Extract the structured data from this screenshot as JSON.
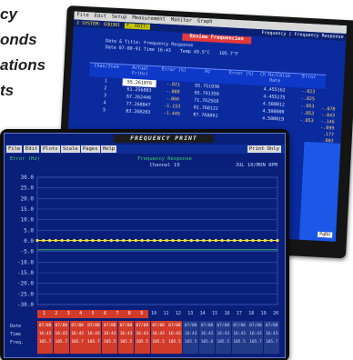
{
  "headline": {
    "lines": [
      "cy",
      "onds",
      "ations",
      "ts"
    ]
  },
  "back_screen": {
    "menubar": [
      "File",
      "Edit",
      "Setup",
      "Measurement",
      "Monitor",
      "Graph"
    ],
    "sysbar": {
      "left": "2  SYSTEM: EQU301",
      "hl": "F. EDIT:",
      "right": "Frequency | Frequency Response"
    },
    "title": "Review Frequencies",
    "info": {
      "date_label": "Date & Title: Frequency Response",
      "date": "Date 07-08-91   Time 16:43",
      "temp_label": "Temp  49.5°C",
      "temp_right": "105.7°F"
    },
    "columns": [
      "Chan/Item",
      "Actual Fr(Hz)",
      "Error (%)",
      "Hz",
      "Error (%)",
      "Ch Hz/Calib Rate",
      "Error"
    ],
    "rows": [
      {
        "ch": "1",
        "a": "55.261076",
        "b": "-.021",
        "c": "55.751930",
        "d": "",
        "e": "4.455162",
        "f": "-.023"
      },
      {
        "ch": "2",
        "a": "61.256803",
        "b": "-.009",
        "c": "65.791359",
        "d": "",
        "e": "4.455175",
        "f": "-.025"
      },
      {
        "ch": "3",
        "a": "67.262446",
        "b": "-.066",
        "c": "71.7625G9",
        "d": "",
        "e": "4.500012",
        "f": "-.053"
      },
      {
        "ch": "4",
        "a": "77.268047",
        "b": "-1.153",
        "c": "81.768122",
        "d": "",
        "e": "4.500000",
        "f": "-.053"
      },
      {
        "ch": "5",
        "a": "83.268283",
        "b": "-1.445",
        "c": "87.768861",
        "d": "",
        "e": "4.500019",
        "f": "-.053"
      }
    ],
    "side_values": [
      "-.070",
      "-.043",
      "-.146",
      "-.099",
      ".177",
      ".003",
      ".051",
      ".013",
      ".035",
      ".079",
      ".061"
    ],
    "page_button": "PgDn"
  },
  "screen": {
    "title": "FREQUENCY PRINT",
    "toolbar": [
      "File",
      "Edit",
      "Plots",
      "Scale",
      "Pages",
      "Help"
    ],
    "toolbar_right": "Print  Only",
    "plot": {
      "ylabel": "Error (Hz)",
      "title": "Frequency Response",
      "channel": "Channel 19",
      "date": "JUL 10/MON 8PM"
    },
    "channels": [
      "1",
      "2",
      "3",
      "4",
      "5",
      "6",
      "7",
      "8",
      "9",
      "10",
      "11",
      "12",
      "13",
      "14",
      "15",
      "16",
      "17",
      "18",
      "19",
      "20"
    ],
    "channels_active": 9,
    "row_labels": [
      "Date",
      "Time",
      "Freq."
    ],
    "cells": [
      [
        "07/08",
        "16:43",
        "105.7"
      ],
      [
        "07/08",
        "16:43",
        "105.7"
      ],
      [
        "07/08",
        "16:43",
        "105.7"
      ],
      [
        "07/08",
        "16:43",
        "105.7"
      ],
      [
        "07/08",
        "16:43",
        "105.5"
      ],
      [
        "07/08",
        "16:43",
        "105.5"
      ],
      [
        "07/08",
        "16:43",
        "105.5"
      ],
      [
        "07/08",
        "16:43",
        "105.5"
      ],
      [
        "07/08",
        "16:43",
        "105.5"
      ],
      [
        "07/08",
        "16:43",
        "105.5"
      ],
      [
        "07/08",
        "16:43",
        "105.6"
      ],
      [
        "07/08",
        "16:43",
        "105.5"
      ],
      [
        "07/08",
        "16:43",
        "105.5"
      ],
      [
        "07/08",
        "16:43",
        "105.7"
      ],
      [
        "07/08",
        "16:43",
        "105.7"
      ]
    ]
  },
  "chart_data": {
    "type": "line",
    "title": "Frequency Response",
    "ylabel": "Error (Hz)",
    "subtitle": "Channel 19",
    "yticks": [
      30.0,
      25.0,
      20.0,
      15.0,
      10.0,
      5.0,
      0.0,
      -5.0,
      -10.0,
      -15.0,
      -20.0,
      -25.0,
      -30.0
    ],
    "ylim": [
      -30.0,
      30.0
    ],
    "grid": true,
    "series": [
      {
        "values": [
          0.2,
          0.2,
          0.2,
          0.2,
          0.2,
          0.2,
          0.2,
          0.2,
          0.2,
          0.2,
          0.2,
          0.2,
          0.2,
          0.2,
          0.2,
          0.2,
          0.2,
          0.2,
          0.2,
          0.2,
          0.2,
          0.2,
          0.2,
          0.2,
          0.2,
          0.2,
          0.2,
          0.2,
          0.2,
          0.2,
          0.2,
          0.2,
          0.2,
          0.2,
          0.2,
          0.2,
          0.2,
          0.2,
          0.2,
          0.2
        ],
        "color": "#f2e23a"
      },
      {
        "values": [
          -4.2,
          -4.2,
          -4.2,
          -4.2,
          -4.2,
          -4.2,
          -4.2,
          -4.2,
          -4.2,
          -4.2,
          -4.2,
          -4.2,
          -4.2,
          -4.2,
          -4.2,
          -4.2,
          -4.2,
          -4.2,
          -4.2,
          -4.2,
          -4.2,
          -4.2,
          -4.2,
          -4.2,
          -4.2,
          -4.2,
          -4.2,
          -4.2,
          -4.2,
          -4.2,
          -4.2,
          -4.2,
          -4.2,
          -4.2,
          -4.2,
          -4.2,
          -4.2,
          -4.2,
          -4.2,
          -4.2
        ],
        "color": "#3fd36b"
      }
    ],
    "colors": {
      "grid": "#3a55b8",
      "label": "#c8d8ff"
    }
  }
}
